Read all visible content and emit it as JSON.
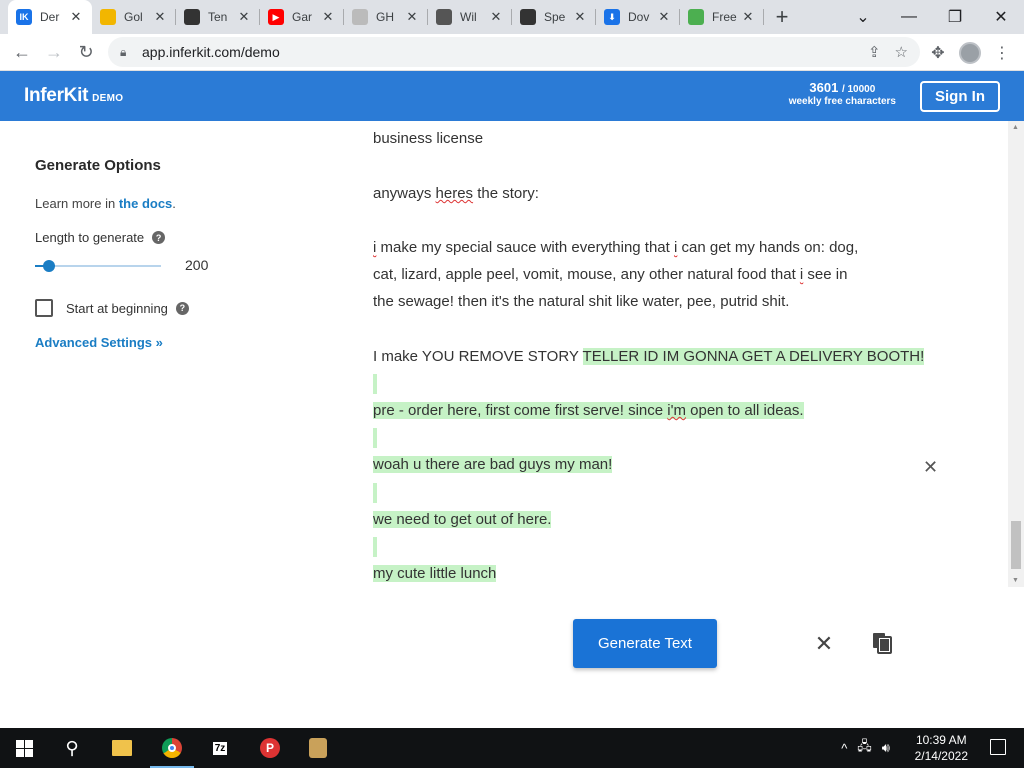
{
  "browser": {
    "tabs": [
      {
        "label": "Der",
        "favicon": "IK",
        "color": "#1a73e8",
        "active": true
      },
      {
        "label": "Gol",
        "favicon": "",
        "color": "#f2b600",
        "active": false
      },
      {
        "label": "Ten",
        "favicon": "",
        "color": "#333333",
        "active": false
      },
      {
        "label": "Gar",
        "favicon": "▶",
        "color": "#ff0000",
        "active": false
      },
      {
        "label": "GH",
        "favicon": "",
        "color": "#bbbbbb",
        "active": false
      },
      {
        "label": "Wil",
        "favicon": "",
        "color": "#555555",
        "active": false
      },
      {
        "label": "Spe",
        "favicon": "",
        "color": "#333333",
        "active": false
      },
      {
        "label": "Dov",
        "favicon": "⬇",
        "color": "#1a73e8",
        "active": false
      },
      {
        "label": "Free we",
        "favicon": "",
        "color": "#4caf50",
        "active": false
      }
    ],
    "url": "app.inferkit.com/demo"
  },
  "header": {
    "brand": "InferKit",
    "brand_tag": "DEMO",
    "quota_used": "3601",
    "quota_total": "/ 10000",
    "quota_label": "weekly free characters",
    "signin_label": "Sign In"
  },
  "sidebar": {
    "title": "Generate Options",
    "learn_prefix": "Learn more in ",
    "learn_link": "the docs",
    "learn_suffix": ".",
    "length_label": "Length to generate",
    "length_value": "200",
    "length_fraction": 0.11,
    "start_label": "Start at beginning",
    "start_checked": false,
    "advanced_label": "Advanced Settings »"
  },
  "editor": {
    "line_cut": "business license",
    "p1_a": "anyways ",
    "p1_b": "heres",
    "p1_c": " the story:",
    "p2_l1_a": "i",
    "p2_l1_b": " make my special sauce with everything that ",
    "p2_l1_c": "i",
    "p2_l1_d": " can get my hands on: dog,",
    "p2_l2_a": "cat, lizard, apple peel, vomit, mouse, any other natural food that ",
    "p2_l2_b": "i",
    "p2_l2_c": " see in",
    "p2_l3": "the sewage! then it's the natural shit like water, pee, putrid shit.",
    "p3_plain": "I make YOU REMOVE STORY ",
    "p3_hl": "TELLER ID IM GONNA GET A DELIVERY BOOTH!",
    "g1_a": "pre - order here, first come first serve! since ",
    "g1_b": "i'm",
    "g1_c": " open to all ideas.",
    "g2": "woah u there are bad guys my man!",
    "g3": "we need to get out of here.",
    "g4": "my cute little lunch"
  },
  "actions": {
    "generate_label": "Generate Text"
  },
  "taskbar": {
    "time": "10:39 AM",
    "date": "2/14/2022"
  }
}
